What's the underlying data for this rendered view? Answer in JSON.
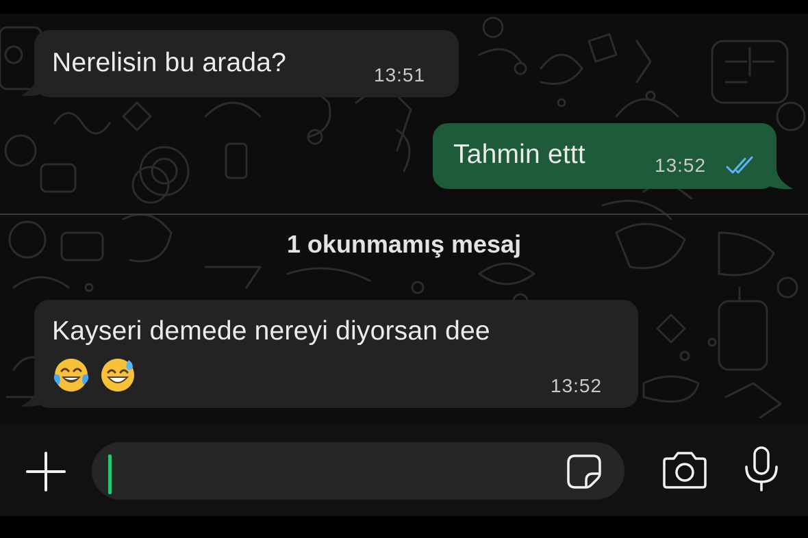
{
  "messages": [
    {
      "direction": "incoming",
      "text": "Nerelisin bu arada?",
      "time": "13:51"
    },
    {
      "direction": "outgoing",
      "text": "Tahmin ettt",
      "time": "13:52",
      "status": "read"
    },
    {
      "direction": "incoming",
      "text": "Kayseri demede nereyi diyorsan dee",
      "emojis": [
        "face-with-tears-of-joy",
        "grinning-face-with-sweat"
      ],
      "time": "13:52"
    }
  ],
  "unread_divider": {
    "label": "1 okunmamış mesaj"
  },
  "composer": {
    "placeholder": "",
    "icons": {
      "attach": "plus-icon",
      "sticker": "sticker-icon",
      "camera": "camera-icon",
      "voice": "microphone-icon"
    }
  },
  "colors": {
    "incoming_bubble": "#222322",
    "outgoing_bubble": "#1d5b3b",
    "read_ticks": "#5fb3f5",
    "cursor": "#28c76f"
  }
}
